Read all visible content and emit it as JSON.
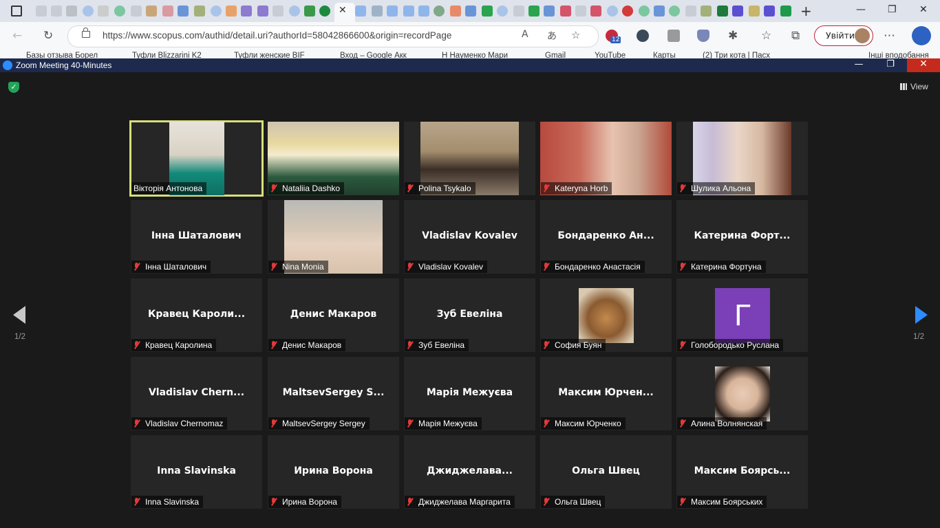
{
  "browser": {
    "url": "https://www.scopus.com/authid/detail.uri?authorId=58042866600&origin=recordPage",
    "login_label": "Увійти",
    "ext_badge": "12",
    "bookmarks": [
      "Базы отзыва Борел",
      "Туфли Blizzarini K2",
      "Туфли женские BIF",
      "Вход – Google Акк",
      "Н Науменко Мари",
      "Gmail",
      "YouTube",
      "Карты",
      "(2) Три кота | Пасх",
      "Інші вподобання"
    ]
  },
  "zoom": {
    "title": "Zoom Meeting 40-Minutes",
    "view_label": "View",
    "page_indicator_left": "1/2",
    "page_indicator_right": "1/2",
    "participants": [
      {
        "name": "Вікторія Антонова",
        "label": "Вікторія Антонова",
        "muted": false,
        "active": true
      },
      {
        "name": "Nataliia Dashko",
        "label": "Nataliia Dashko",
        "muted": true
      },
      {
        "name": "Polina Tsykalo",
        "label": "Polina Tsykalo",
        "muted": true
      },
      {
        "name": "Kateryna Horb",
        "label": "Kateryna Horb",
        "muted": true
      },
      {
        "name": "Шулика Альона",
        "label": "Шулика Альона",
        "muted": true
      },
      {
        "name": "Інна Шаталович",
        "label": "Інна Шаталович",
        "muted": true
      },
      {
        "name": "Nina Monia",
        "label": "Nina Monia",
        "muted": true
      },
      {
        "name": "Vladislav Kovalev",
        "label": "Vladislav Kovalev",
        "muted": true
      },
      {
        "name": "Бондаренко  Ан...",
        "label": "Бондаренко Анастасія",
        "muted": true
      },
      {
        "name": "Катерина  Форт...",
        "label": "Катерина Фортуна",
        "muted": true
      },
      {
        "name": "Кравец  Кароли...",
        "label": "Кравец Каролина",
        "muted": true
      },
      {
        "name": "Денис Макаров",
        "label": "Денис Макаров",
        "muted": true
      },
      {
        "name": "Зуб Евеліна",
        "label": "Зуб Евеліна",
        "muted": true
      },
      {
        "name": "София Буян",
        "label": "София Буян",
        "muted": true
      },
      {
        "name": "Голобородько Руслана",
        "label": "Голобородько Руслана",
        "muted": true,
        "avatar_letter": "Г"
      },
      {
        "name": "Vladislav  Chern...",
        "label": "Vladislav Chernomaz",
        "muted": true
      },
      {
        "name": "MaltsevSergey  S...",
        "label": "MaltsevSergey Sergey",
        "muted": true
      },
      {
        "name": "Марія Межуєва",
        "label": "Марія Межуєва",
        "muted": true
      },
      {
        "name": "Максим  Юрчен...",
        "label": "Максим Юрченко",
        "muted": true
      },
      {
        "name": "Алина Волнянская",
        "label": "Алина Волнянская",
        "muted": true
      },
      {
        "name": "Inna Slavinska",
        "label": "Inna Slavinska",
        "muted": true
      },
      {
        "name": "Ирина Ворона",
        "label": "Ирина Ворона",
        "muted": true
      },
      {
        "name": "Джиджелава...",
        "label": "Джиджелава Маргарита",
        "muted": true
      },
      {
        "name": "Ольга Швец",
        "label": "Ольга Швец",
        "muted": true
      },
      {
        "name": "Максим  Боярсь...",
        "label": "Максим Боярських",
        "muted": true
      }
    ]
  },
  "colors": {
    "active_speaker_border": "#d7e07a",
    "mute_icon": "#e03a3a",
    "tile_bg": "#262626",
    "pager_arrow": "#2d8cff",
    "zoom_titlebar": "#1d2a4d"
  }
}
